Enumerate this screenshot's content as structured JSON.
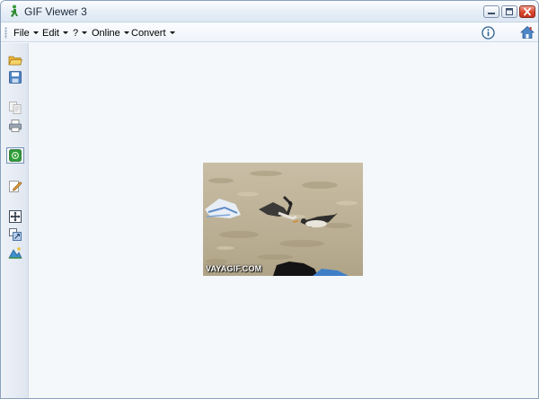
{
  "window": {
    "title": "GIF Viewer 3"
  },
  "menubar": {
    "items": [
      {
        "label": "File"
      },
      {
        "label": "Edit"
      },
      {
        "label": "?"
      },
      {
        "label": "Online"
      },
      {
        "label": "Convert"
      }
    ]
  },
  "toolbar": {
    "items": [
      {
        "icon": "open-folder-icon"
      },
      {
        "icon": "save-icon"
      },
      {
        "icon": "copy-icon",
        "disabled": true
      },
      {
        "icon": "print-icon"
      },
      {
        "icon": "play-icon",
        "selected": true
      },
      {
        "icon": "edit-icon"
      },
      {
        "icon": "move-icon"
      },
      {
        "icon": "resize-icon"
      },
      {
        "icon": "image-icon"
      }
    ]
  },
  "image": {
    "watermark": "VAYAGIF.COM",
    "colors": {
      "sand": "#cbbfa5",
      "sand_dark": "#a89b82",
      "towel": "#3f7fc7"
    }
  }
}
